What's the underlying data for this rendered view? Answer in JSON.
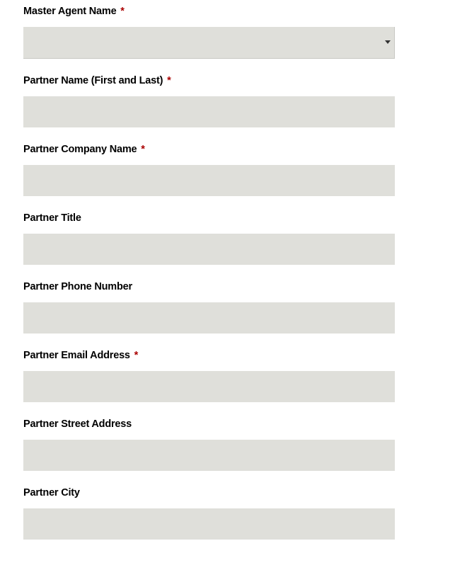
{
  "form": {
    "fields": [
      {
        "label": "Master Agent Name",
        "required": true,
        "type": "select",
        "value": ""
      },
      {
        "label": "Partner Name (First and Last)",
        "required": true,
        "type": "text",
        "value": ""
      },
      {
        "label": "Partner Company Name",
        "required": true,
        "type": "text",
        "value": ""
      },
      {
        "label": "Partner Title",
        "required": false,
        "type": "text",
        "value": ""
      },
      {
        "label": "Partner Phone Number",
        "required": false,
        "type": "text",
        "value": ""
      },
      {
        "label": "Partner Email Address",
        "required": true,
        "type": "text",
        "value": ""
      },
      {
        "label": "Partner Street Address",
        "required": false,
        "type": "text",
        "value": ""
      },
      {
        "label": "Partner City",
        "required": false,
        "type": "text",
        "value": ""
      }
    ],
    "required_marker": "*"
  }
}
